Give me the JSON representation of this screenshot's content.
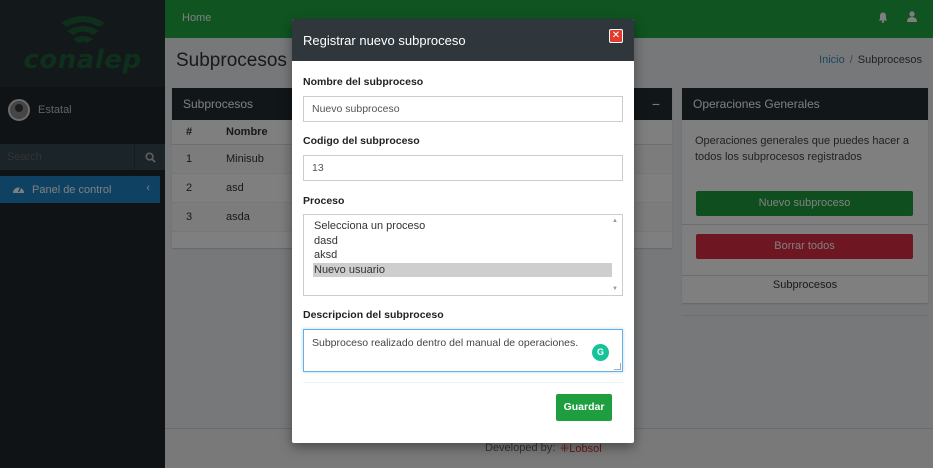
{
  "sidebar": {
    "logo_text": "conalep",
    "user_name": "Estatal",
    "search_placeholder": "Search",
    "menu_item": "Panel de control"
  },
  "header": {
    "home": "Home"
  },
  "page": {
    "title": "Subprocesos",
    "breadcrumb_home": "Inicio",
    "breadcrumb_current": "Subprocesos"
  },
  "table_box": {
    "title": "Subprocesos",
    "columns": [
      "#",
      "Nombre"
    ],
    "rows": [
      {
        "num": "1",
        "nombre": "Minisub"
      },
      {
        "num": "2",
        "nombre": "asd"
      },
      {
        "num": "3",
        "nombre": "asda"
      }
    ]
  },
  "ops_box": {
    "title": "Operaciones Generales",
    "description": "Operaciones generales que puedes hacer a todos los subprocesos registrados",
    "new_button": "Nuevo subproceso",
    "delete_button": "Borrar todos",
    "list_link": "Subprocesos"
  },
  "footer": {
    "developed_by": "Developed by:",
    "brand": "Lobsol"
  },
  "modal": {
    "title": "Registrar nuevo subproceso",
    "name_label": "Nombre del subproceso",
    "name_value": "Nuevo subproceso",
    "code_label": "Codigo del subproceso",
    "code_value": "13",
    "process_label": "Proceso",
    "process_options": [
      "Selecciona un proceso",
      "dasd",
      "aksd",
      "Nuevo usuario"
    ],
    "process_selected": "Nuevo usuario",
    "description_label": "Descripcion del subproceso",
    "description_value": "Subproceso realizado dentro del manual de operaciones.",
    "save_button": "Guardar"
  },
  "colors": {
    "header_green": "#20a845",
    "sidebar_dark": "#1f262b",
    "menu_blue": "#1f84c5",
    "btn_green": "#1e9e3e",
    "btn_red": "#dd2d43"
  }
}
